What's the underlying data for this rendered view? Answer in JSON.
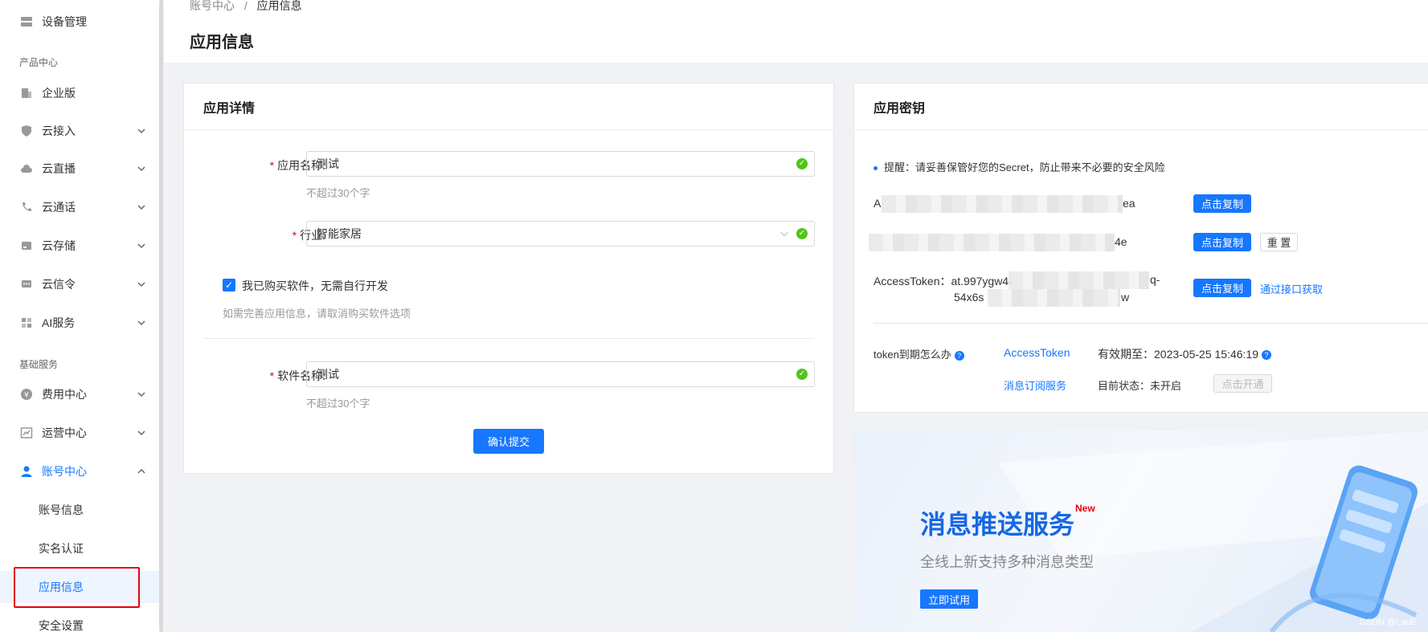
{
  "sidebar": {
    "top_item": "设备管理",
    "group_product": "产品中心",
    "items_product": [
      {
        "label": "企业版"
      },
      {
        "label": "云接入"
      },
      {
        "label": "云直播"
      },
      {
        "label": "云通话"
      },
      {
        "label": "云存储"
      },
      {
        "label": "云信令"
      },
      {
        "label": "AI服务"
      }
    ],
    "group_basic": "基础服务",
    "items_basic": [
      {
        "label": "费用中心"
      },
      {
        "label": "运营中心"
      },
      {
        "label": "账号中心"
      }
    ],
    "sub_items": [
      {
        "label": "账号信息"
      },
      {
        "label": "实名认证"
      },
      {
        "label": "应用信息"
      },
      {
        "label": "安全设置"
      }
    ]
  },
  "breadcrumb": {
    "parent": "账号中心",
    "separator": "/",
    "current": "应用信息"
  },
  "page_title": "应用信息",
  "app_detail": {
    "title": "应用详情",
    "name_label": "应用名称:",
    "name_value": "测试",
    "name_hint": "不超过30个字",
    "industry_label": "行业:",
    "industry_value": "智能家居",
    "checkbox_label": "我已购买软件，无需自行开发",
    "checkbox_hint": "如需完善应用信息，请取消购买软件选项",
    "software_label": "软件名称:",
    "software_value": "测试",
    "software_hint": "不超过30个字",
    "submit": "确认提交"
  },
  "app_key": {
    "title": "应用密钥",
    "notice": "提醒：请妥善保管好您的Secret，防止带来不必要的安全风险",
    "appkey_prefix": "A",
    "appkey_suffix": "ea",
    "secret_suffix": "4e",
    "copy": "点击复制",
    "reset": "重 置",
    "token_label": "AccessToken：at.997ygw4-",
    "token_line1_suffix": "q-",
    "token_line2_prefix": "54x6s",
    "token_line2_suffix": "w",
    "api_link": "通过接口获取",
    "expire_question": "token到期怎么办",
    "access_token_link": "AccessToken",
    "expire_text": "有效期至：2023-05-25 15:46:19",
    "subscribe_link": "消息订阅服务",
    "status_text": "目前状态：未开启",
    "activate": "点击开通"
  },
  "banner": {
    "title": "消息推送服务",
    "new_badge": "New",
    "subtitle": "全线上新支持多种消息类型",
    "button": "立即试用",
    "watermark": "CSDN @LauE"
  },
  "colors": {
    "accent": "#1677ff",
    "required": "#e60012",
    "success": "#52c41a"
  }
}
